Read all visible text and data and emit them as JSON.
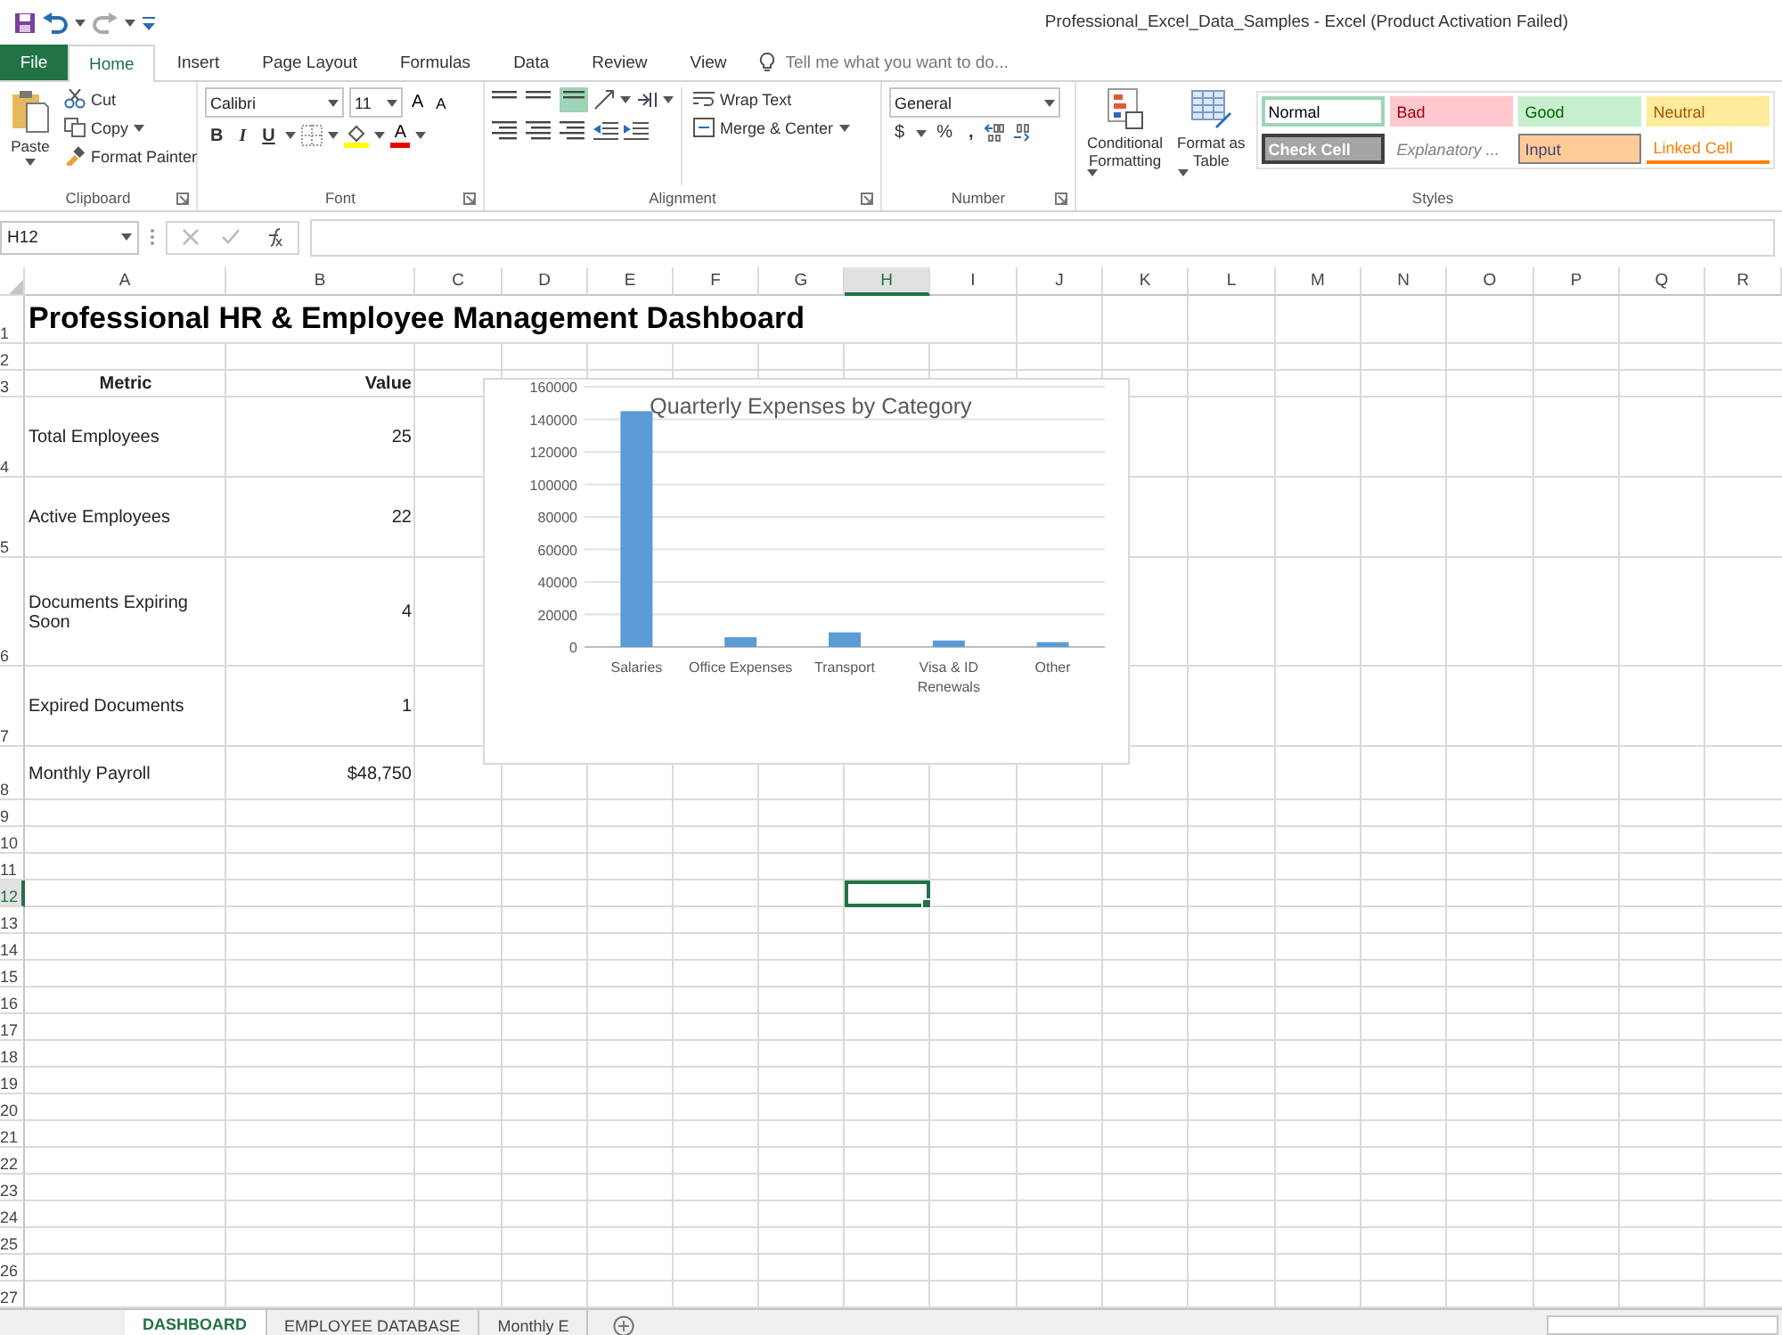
{
  "title_bar": {
    "title": "Professional_Excel_Data_Samples - Excel (Product Activation Failed)"
  },
  "ribbon_tabs": [
    {
      "label": "File",
      "kind": "file",
      "selected": false
    },
    {
      "label": "Home",
      "kind": "tab",
      "selected": true
    },
    {
      "label": "Insert",
      "kind": "tab",
      "selected": false
    },
    {
      "label": "Page Layout",
      "kind": "tab",
      "selected": false
    },
    {
      "label": "Formulas",
      "kind": "tab",
      "selected": false
    },
    {
      "label": "Data",
      "kind": "tab",
      "selected": false
    },
    {
      "label": "Review",
      "kind": "tab",
      "selected": false
    },
    {
      "label": "View",
      "kind": "tab",
      "selected": false
    }
  ],
  "tell_me": {
    "placeholder": "Tell me what you want to do..."
  },
  "clipboard": {
    "paste": "Paste",
    "cut": "Cut",
    "copy": "Copy",
    "format_painter": "Format Painter",
    "label": "Clipboard"
  },
  "font": {
    "name": "Calibri",
    "size": "11",
    "grow": "A",
    "shrink": "A",
    "bold": "B",
    "italic": "I",
    "underline": "U",
    "font_color_glyph": "A",
    "label": "Font"
  },
  "alignment": {
    "wrap_text": "Wrap Text",
    "merge": "Merge & Center",
    "label": "Alignment"
  },
  "number": {
    "format": "General",
    "currency": "$",
    "percent": "%",
    "comma": ",",
    "label": "Number"
  },
  "styles": {
    "conditional": "Conditional Formatting",
    "format_table": "Format as Table",
    "label": "Styles",
    "cells": [
      {
        "label": "Normal",
        "kind": "normal",
        "selected": true
      },
      {
        "label": "Bad",
        "kind": "bad",
        "selected": false
      },
      {
        "label": "Good",
        "kind": "good",
        "selected": false
      },
      {
        "label": "Neutral",
        "kind": "neutral",
        "selected": false
      },
      {
        "label": "Check Cell",
        "kind": "check",
        "selected": false
      },
      {
        "label": "Explanatory ...",
        "kind": "explanatory",
        "selected": false
      },
      {
        "label": "Input",
        "kind": "input",
        "selected": false
      },
      {
        "label": "Linked Cell",
        "kind": "linked",
        "selected": false
      }
    ]
  },
  "formula_bar": {
    "name_box": "H12"
  },
  "sheet": {
    "columns": [
      {
        "label": "A",
        "selected": false
      },
      {
        "label": "B",
        "selected": false
      },
      {
        "label": "C",
        "selected": false
      },
      {
        "label": "D",
        "selected": false
      },
      {
        "label": "E",
        "selected": false
      },
      {
        "label": "F",
        "selected": false
      },
      {
        "label": "G",
        "selected": false
      },
      {
        "label": "H",
        "selected": true
      },
      {
        "label": "I",
        "selected": false
      },
      {
        "label": "J",
        "selected": false
      },
      {
        "label": "K",
        "selected": false
      },
      {
        "label": "L",
        "selected": false
      },
      {
        "label": "M",
        "selected": false
      },
      {
        "label": "N",
        "selected": false
      },
      {
        "label": "O",
        "selected": false
      },
      {
        "label": "P",
        "selected": false
      },
      {
        "label": "Q",
        "selected": false
      },
      {
        "label": "R",
        "selected": false
      }
    ],
    "rows": [
      {
        "number": "1",
        "kind": "title",
        "selected": false,
        "cells": [
          "Professional HR & Employee Management Dashboard"
        ]
      },
      {
        "number": "2",
        "kind": "data",
        "selected": false,
        "cells": []
      },
      {
        "number": "3",
        "kind": "header",
        "selected": false,
        "cells": [
          "Metric",
          "Value"
        ]
      },
      {
        "number": "4",
        "kind": "data",
        "selected": false,
        "cells": [
          "Total Employees",
          "25"
        ]
      },
      {
        "number": "5",
        "kind": "data",
        "selected": false,
        "cells": [
          "Active Employees",
          "22"
        ]
      },
      {
        "number": "6",
        "kind": "data",
        "selected": false,
        "cells": [
          "Documents Expiring Soon",
          "4"
        ]
      },
      {
        "number": "7",
        "kind": "data",
        "selected": false,
        "cells": [
          "Expired Documents",
          "1"
        ]
      },
      {
        "number": "8",
        "kind": "data",
        "selected": false,
        "cells": [
          "Monthly Payroll",
          "$48,750"
        ]
      },
      {
        "number": "9",
        "kind": "data",
        "selected": false,
        "cells": []
      },
      {
        "number": "10",
        "kind": "data",
        "selected": false,
        "cells": []
      },
      {
        "number": "11",
        "kind": "data",
        "selected": false,
        "cells": []
      },
      {
        "number": "12",
        "kind": "data",
        "selected": true,
        "cells": []
      },
      {
        "number": "13",
        "kind": "data",
        "selected": false,
        "cells": []
      },
      {
        "number": "14",
        "kind": "data",
        "selected": false,
        "cells": []
      },
      {
        "number": "15",
        "kind": "data",
        "selected": false,
        "cells": []
      },
      {
        "number": "16",
        "kind": "data",
        "selected": false,
        "cells": []
      },
      {
        "number": "17",
        "kind": "data",
        "selected": false,
        "cells": []
      },
      {
        "number": "18",
        "kind": "data",
        "selected": false,
        "cells": []
      },
      {
        "number": "19",
        "kind": "data",
        "selected": false,
        "cells": []
      },
      {
        "number": "20",
        "kind": "data",
        "selected": false,
        "cells": []
      },
      {
        "number": "21",
        "kind": "data",
        "selected": false,
        "cells": []
      },
      {
        "number": "22",
        "kind": "data",
        "selected": false,
        "cells": []
      },
      {
        "number": "23",
        "kind": "data",
        "selected": false,
        "cells": []
      },
      {
        "number": "24",
        "kind": "data",
        "selected": false,
        "cells": []
      },
      {
        "number": "25",
        "kind": "data",
        "selected": false,
        "cells": []
      },
      {
        "number": "26",
        "kind": "data",
        "selected": false,
        "cells": []
      },
      {
        "number": "27",
        "kind": "data",
        "selected": false,
        "cells": []
      }
    ],
    "chart": {
      "chart_data": {
        "type": "bar",
        "title": "Quarterly Expenses by Category",
        "categories": [
          "Salaries",
          "Office Expenses",
          "Transport",
          "Visa & ID Renewals",
          "Other"
        ],
        "values": [
          145000,
          6000,
          9000,
          4000,
          3000
        ],
        "grid": true,
        "ylim": [
          0,
          160000
        ],
        "yticks": [
          0,
          20000,
          40000,
          60000,
          80000,
          100000,
          120000,
          140000,
          160000
        ]
      }
    }
  },
  "sheet_tabs": [
    {
      "label": "DASHBOARD",
      "selected": true
    },
    {
      "label": "EMPLOYEE DATABASE",
      "selected": false
    },
    {
      "label": "Monthly E",
      "selected": false
    }
  ]
}
